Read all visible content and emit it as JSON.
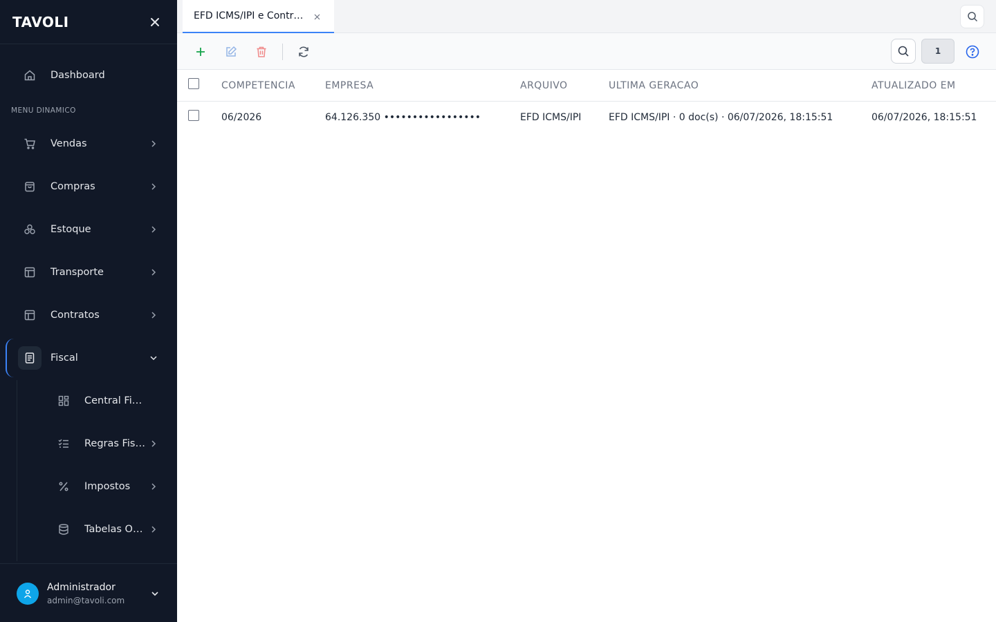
{
  "sidebar": {
    "logo": "TAVOLI",
    "section_label": "MENU DINAMICO",
    "dashboard": "Dashboard",
    "items": [
      {
        "label": "Vendas",
        "icon": "cart-icon"
      },
      {
        "label": "Compras",
        "icon": "bag-icon"
      },
      {
        "label": "Estoque",
        "icon": "boxes-icon"
      },
      {
        "label": "Transporte",
        "icon": "layout-icon"
      },
      {
        "label": "Contratos",
        "icon": "layout-icon"
      },
      {
        "label": "Fiscal",
        "icon": "document-icon"
      }
    ],
    "subitems": [
      {
        "label": "Central Fiscal",
        "icon": "grid-icon"
      },
      {
        "label": "Regras Fiscais",
        "icon": "checklist-icon"
      },
      {
        "label": "Impostos",
        "icon": "percent-icon"
      },
      {
        "label": "Tabelas Oficiais",
        "icon": "database-icon"
      }
    ],
    "user": {
      "name": "Administrador",
      "email": "admin@tavoli.com"
    }
  },
  "tabs": [
    {
      "label": "EFD ICMS/IPI e Contribuições"
    }
  ],
  "toolbar": {
    "page": "1"
  },
  "table": {
    "headers": [
      "COMPETENCIA",
      "EMPRESA",
      "ARQUIVO",
      "ULTIMA GERACAO",
      "ATUALIZADO EM"
    ],
    "rows": [
      [
        "06/2026",
        "64.126.350 •••••••••••••••••",
        "EFD ICMS/IPI",
        "EFD ICMS/IPI · 0 doc(s) · 06/07/2026, 18:15:51",
        "06/07/2026, 18:15:51"
      ]
    ]
  },
  "colors": {
    "sidebar_bg": "#111827",
    "accent": "#3b82f6",
    "add": "#16a34a",
    "delete": "#ef4444",
    "avatar": "#0ea5e9"
  }
}
